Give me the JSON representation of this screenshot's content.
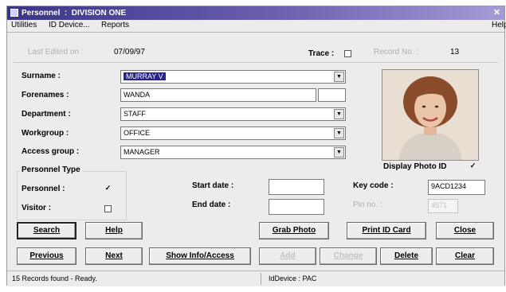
{
  "window": {
    "title": "Personnel  :  DIVISION ONE",
    "close_glyph": "✕"
  },
  "menu": [
    "Utilities",
    "ID Device...",
    "Reports",
    "Help"
  ],
  "header": {
    "last_edited_label": "Last Edited on :",
    "last_edited_value": "07/09/97",
    "trace_label": "Trace :",
    "record_no_label": "Record No. :",
    "record_no_value": "13"
  },
  "form": {
    "surname_label": "Surname :",
    "surname_value": "MURRAY V",
    "forenames_label": "Forenames :",
    "forenames_value": "WANDA",
    "department_label": "Department :",
    "department_value": "STAFF",
    "workgroup_label": "Workgroup :",
    "workgroup_value": "OFFICE",
    "access_group_label": "Access group :",
    "access_group_value": "MANAGER",
    "personnel_type_label": "Personnel Type",
    "personnel_label": "Personnel :",
    "personnel_checked": true,
    "visitor_label": "Visitor :",
    "visitor_checked": false,
    "start_date_label": "Start date :",
    "start_date_value": "",
    "end_date_label": "End date :",
    "end_date_value": "",
    "key_code_label": "Key code :",
    "key_code_value": "9ACD1234",
    "pin_no_label": "Pin no. :",
    "pin_no_value": "4571",
    "display_photo_label": "Display Photo ID",
    "display_photo_checked": true
  },
  "buttons": {
    "search": "Search",
    "help": "Help",
    "grab_photo": "Grab Photo",
    "print_id_card": "Print ID Card",
    "close": "Close",
    "previous": "Previous",
    "next": "Next",
    "show_info_access": "Show Info/Access",
    "add": "Add",
    "change": "Change",
    "delete": "Delete",
    "clear": "Clear"
  },
  "status": {
    "records": "15 Records found  -  Ready.",
    "device": "IdDevice : PAC"
  },
  "colors": {
    "title_gradient_start": "#3a3488",
    "title_gradient_end": "#a69ad6",
    "selection": "#27248a"
  }
}
